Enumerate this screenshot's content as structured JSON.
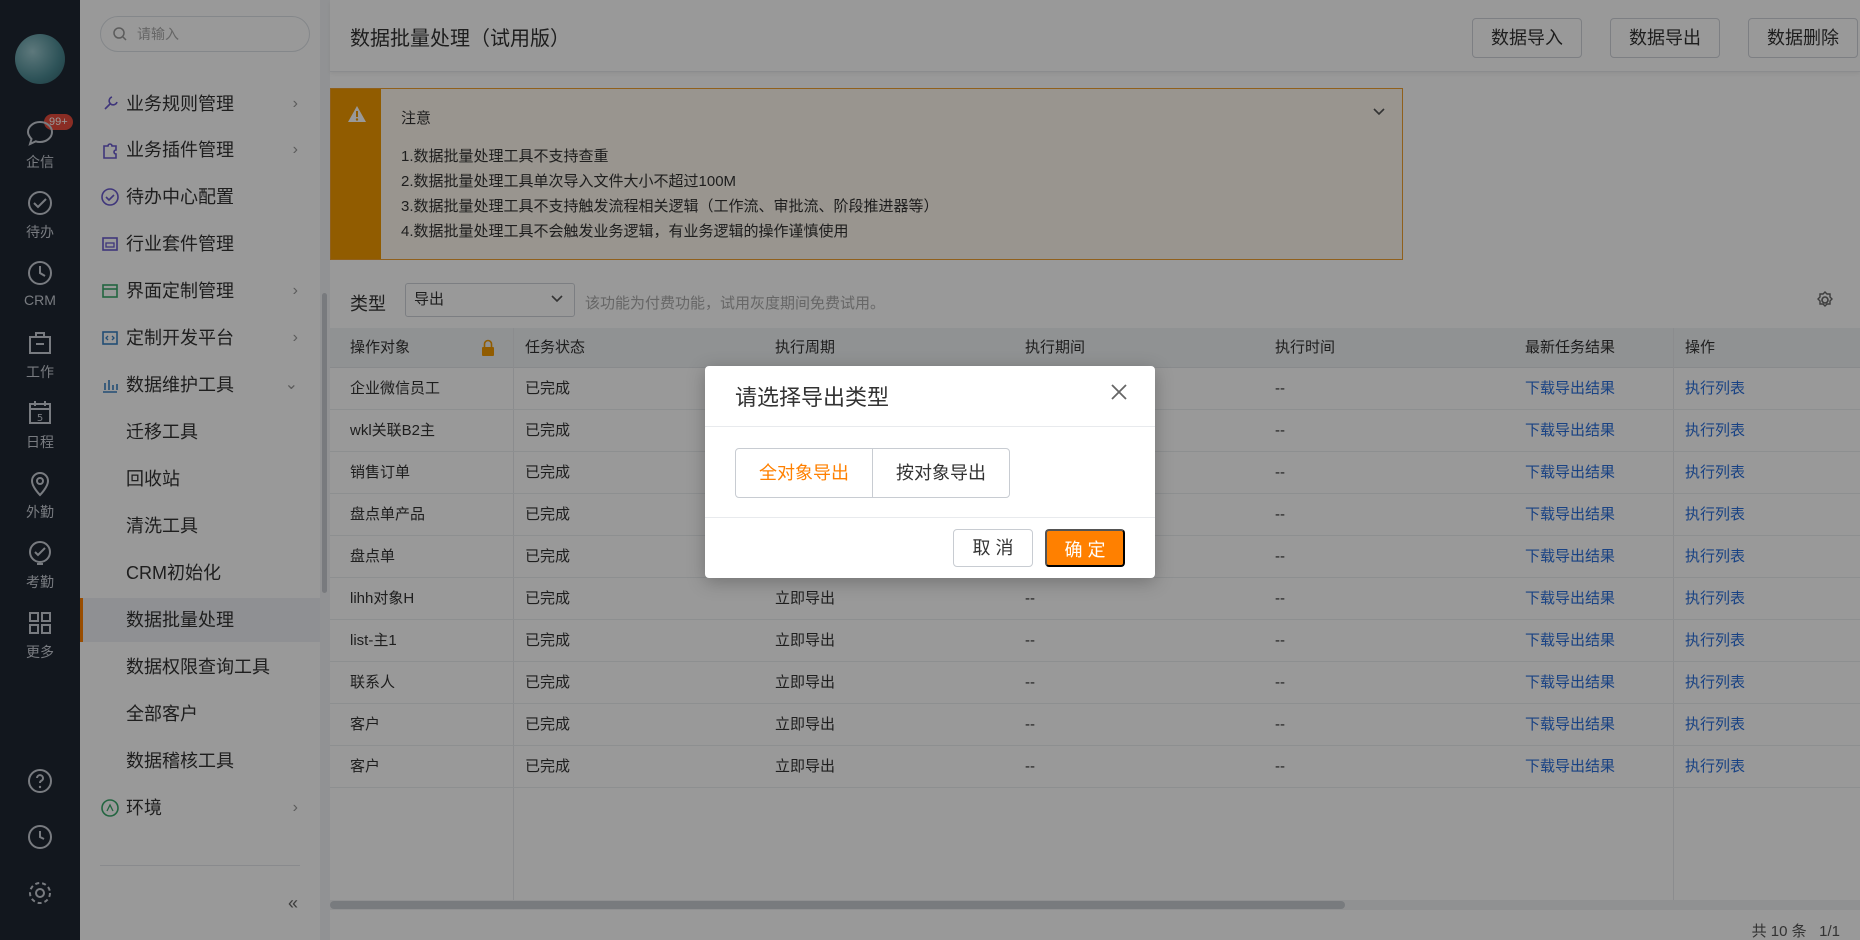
{
  "rail": {
    "badge": "99+",
    "items": [
      {
        "label": "企信",
        "icon": "chat-icon"
      },
      {
        "label": "待办",
        "icon": "check-circle-icon"
      },
      {
        "label": "CRM",
        "icon": "clock-icon"
      },
      {
        "label": "工作",
        "icon": "briefcase-icon"
      },
      {
        "label": "日程",
        "icon": "calendar-icon",
        "day": "5"
      },
      {
        "label": "外勤",
        "icon": "location-icon"
      },
      {
        "label": "考勤",
        "icon": "attendance-icon"
      },
      {
        "label": "更多",
        "icon": "grid-icon"
      }
    ]
  },
  "sidebar": {
    "search_placeholder": "请输入",
    "items": [
      {
        "label": "业务规则管理",
        "arrow": "›"
      },
      {
        "label": "业务插件管理",
        "arrow": "›"
      },
      {
        "label": "待办中心配置",
        "arrow": ""
      },
      {
        "label": "行业套件管理",
        "arrow": ""
      },
      {
        "label": "界面定制管理",
        "arrow": "›"
      },
      {
        "label": "定制开发平台",
        "arrow": "›"
      },
      {
        "label": "数据维护工具",
        "arrow": "⌄"
      },
      {
        "label": "迁移工具"
      },
      {
        "label": "回收站"
      },
      {
        "label": "清洗工具"
      },
      {
        "label": "CRM初始化"
      },
      {
        "label": "数据批量处理"
      },
      {
        "label": "数据权限查询工具"
      },
      {
        "label": "全部客户"
      },
      {
        "label": "数据稽核工具"
      },
      {
        "label": "环境",
        "arrow": "›"
      }
    ],
    "collapse": "«"
  },
  "header": {
    "title": "数据批量处理（试用版）",
    "buttons": [
      "数据导入",
      "数据导出",
      "数据删除"
    ]
  },
  "notice": {
    "title": "注意",
    "lines": [
      "1.数据批量处理工具不支持查重",
      "2.数据批量处理工具单次导入文件大小不超过100M",
      "3.数据批量处理工具不支持触发流程相关逻辑（工作流、审批流、阶段推进器等）",
      "4.数据批量处理工具不会触发业务逻辑，有业务逻辑的操作谨慎使用"
    ]
  },
  "filter": {
    "label": "类型",
    "value": "导出",
    "hint": "该功能为付费功能，试用灰度期间免费试用。"
  },
  "table": {
    "columns": [
      "操作对象",
      "任务状态",
      "执行周期",
      "执行期间",
      "执行时间",
      "最新任务结果",
      "操作"
    ],
    "rows": [
      [
        "企业微信员工",
        "已完成",
        "",
        "",
        "--",
        "下载导出结果",
        "执行列表"
      ],
      [
        "wkl关联B2主",
        "已完成",
        "",
        "",
        "--",
        "下载导出结果",
        "执行列表"
      ],
      [
        "销售订单",
        "已完成",
        "",
        "",
        "--",
        "下载导出结果",
        "执行列表"
      ],
      [
        "盘点单产品",
        "已完成",
        "",
        "",
        "--",
        "下载导出结果",
        "执行列表"
      ],
      [
        "盘点单",
        "已完成",
        "",
        "",
        "--",
        "下载导出结果",
        "执行列表"
      ],
      [
        "lihh对象H",
        "已完成",
        "立即导出",
        "--",
        "--",
        "下载导出结果",
        "执行列表"
      ],
      [
        "list-主1",
        "已完成",
        "立即导出",
        "--",
        "--",
        "下载导出结果",
        "执行列表"
      ],
      [
        "联系人",
        "已完成",
        "立即导出",
        "--",
        "--",
        "下载导出结果",
        "执行列表"
      ],
      [
        "客户",
        "已完成",
        "立即导出",
        "--",
        "--",
        "下载导出结果",
        "执行列表"
      ],
      [
        "客户",
        "已完成",
        "立即导出",
        "--",
        "--",
        "下载导出结果",
        "执行列表"
      ]
    ]
  },
  "pager": {
    "total": "共 10 条",
    "page": "1/1"
  },
  "modal": {
    "title": "请选择导出类型",
    "options": [
      "全对象导出",
      "按对象导出"
    ],
    "cancel": "取 消",
    "ok": "确 定"
  },
  "colors": {
    "accent": "#ff8000",
    "link": "#2a6fdb",
    "warning": "#f29a00",
    "rail": "#1f2733"
  }
}
